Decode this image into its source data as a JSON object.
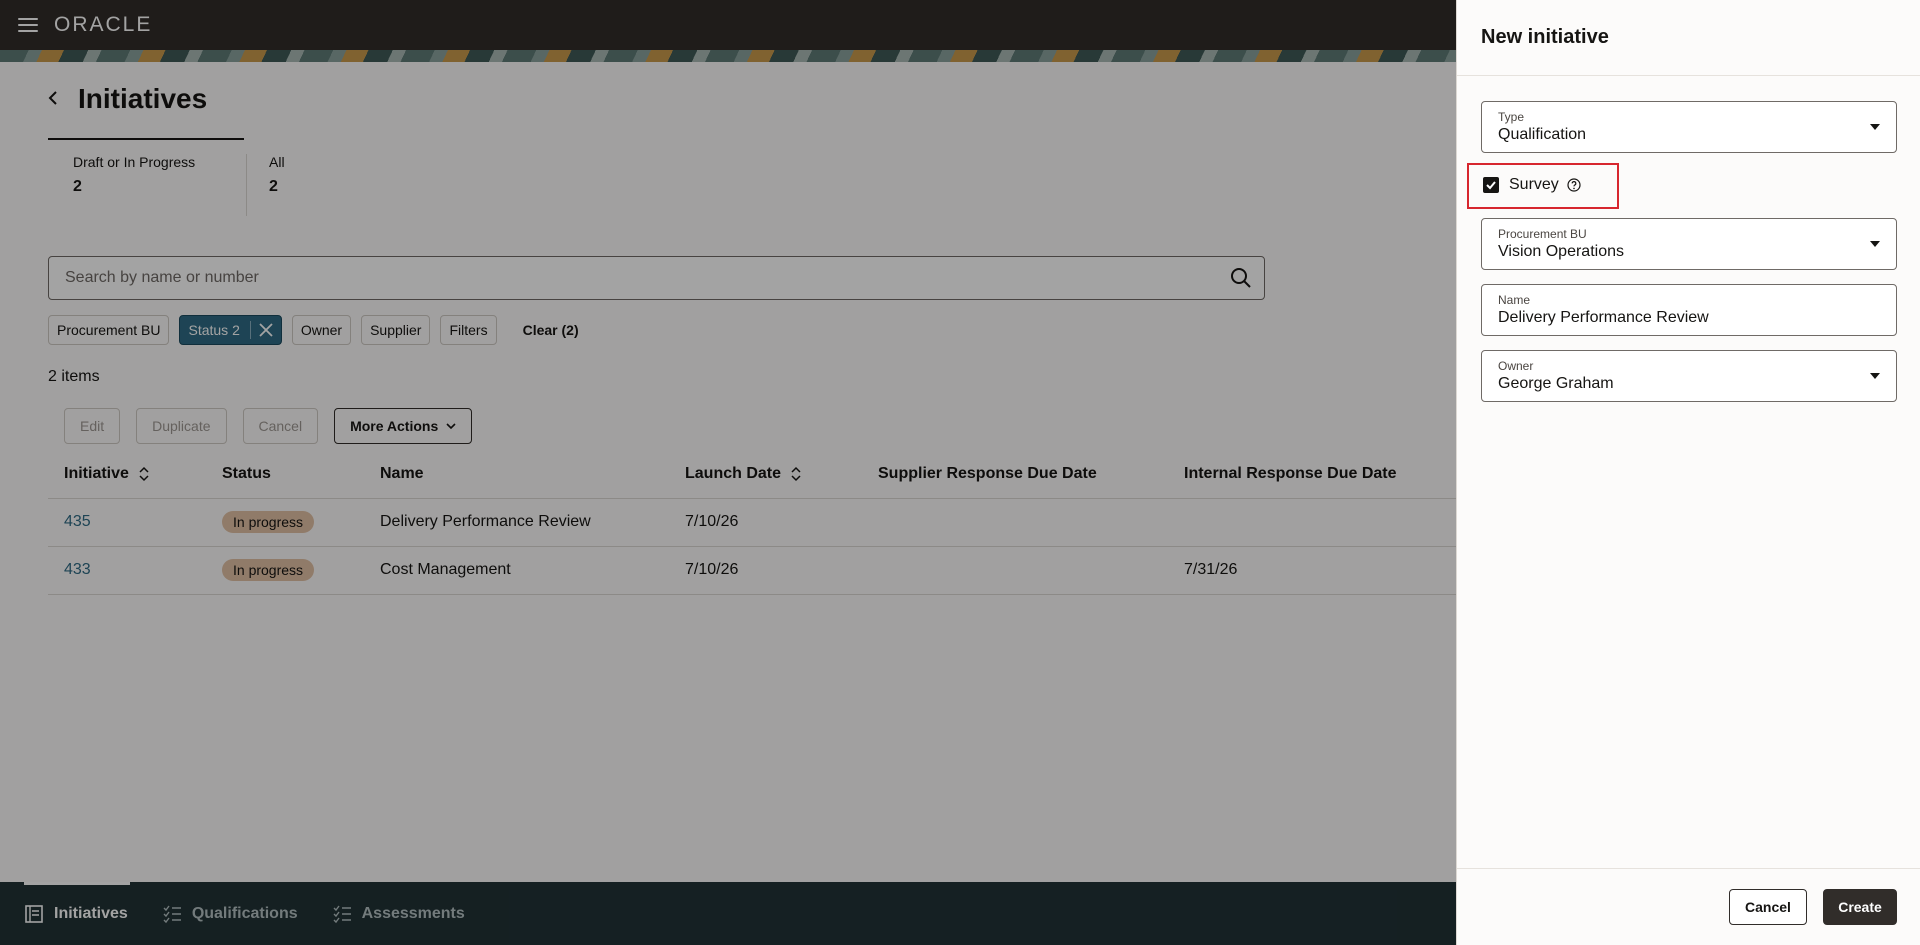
{
  "header": {
    "logo": "ORACLE"
  },
  "page": {
    "title": "Initiatives",
    "tiles": [
      {
        "label": "Draft or In Progress",
        "count": "2"
      },
      {
        "label": "All",
        "count": "2"
      }
    ],
    "search": {
      "placeholder": "Search by name or number",
      "value": ""
    },
    "chips": [
      {
        "label": "Procurement BU"
      },
      {
        "label": "Status 2",
        "active": true
      },
      {
        "label": "Owner"
      },
      {
        "label": "Supplier"
      },
      {
        "label": "Filters"
      }
    ],
    "clear_label": "Clear (2)",
    "items_count": "2 items",
    "actions": {
      "edit": "Edit",
      "duplicate": "Duplicate",
      "cancel": "Cancel",
      "more": "More Actions"
    },
    "table": {
      "columns": [
        "Initiative",
        "Status",
        "Name",
        "Launch Date",
        "Supplier Response Due Date",
        "Internal Response Due Date"
      ],
      "rows": [
        {
          "initiative": "435",
          "status": "In progress",
          "name": "Delivery Performance Review",
          "launch_date": "7/10/26",
          "supplier_due": "",
          "internal_due": ""
        },
        {
          "initiative": "433",
          "status": "In progress",
          "name": "Cost Management",
          "launch_date": "7/10/26",
          "supplier_due": "",
          "internal_due": "7/31/26"
        }
      ]
    }
  },
  "bottom_nav": [
    {
      "label": "Initiatives",
      "active": true
    },
    {
      "label": "Qualifications"
    },
    {
      "label": "Assessments"
    }
  ],
  "drawer": {
    "title": "New initiative",
    "type": {
      "label": "Type",
      "value": "Qualification"
    },
    "survey": {
      "label": "Survey",
      "checked": true
    },
    "procurement_bu": {
      "label": "Procurement BU",
      "value": "Vision Operations"
    },
    "name": {
      "label": "Name",
      "value": "Delivery Performance Review"
    },
    "owner": {
      "label": "Owner",
      "value": "George Graham"
    },
    "cancel_label": "Cancel",
    "create_label": "Create"
  },
  "colors": {
    "header_bg": "#312d2a",
    "nav_bg": "#213236",
    "link": "#2f6b85",
    "status_badge": "#e2c1a4",
    "highlight": "#d7262e"
  }
}
